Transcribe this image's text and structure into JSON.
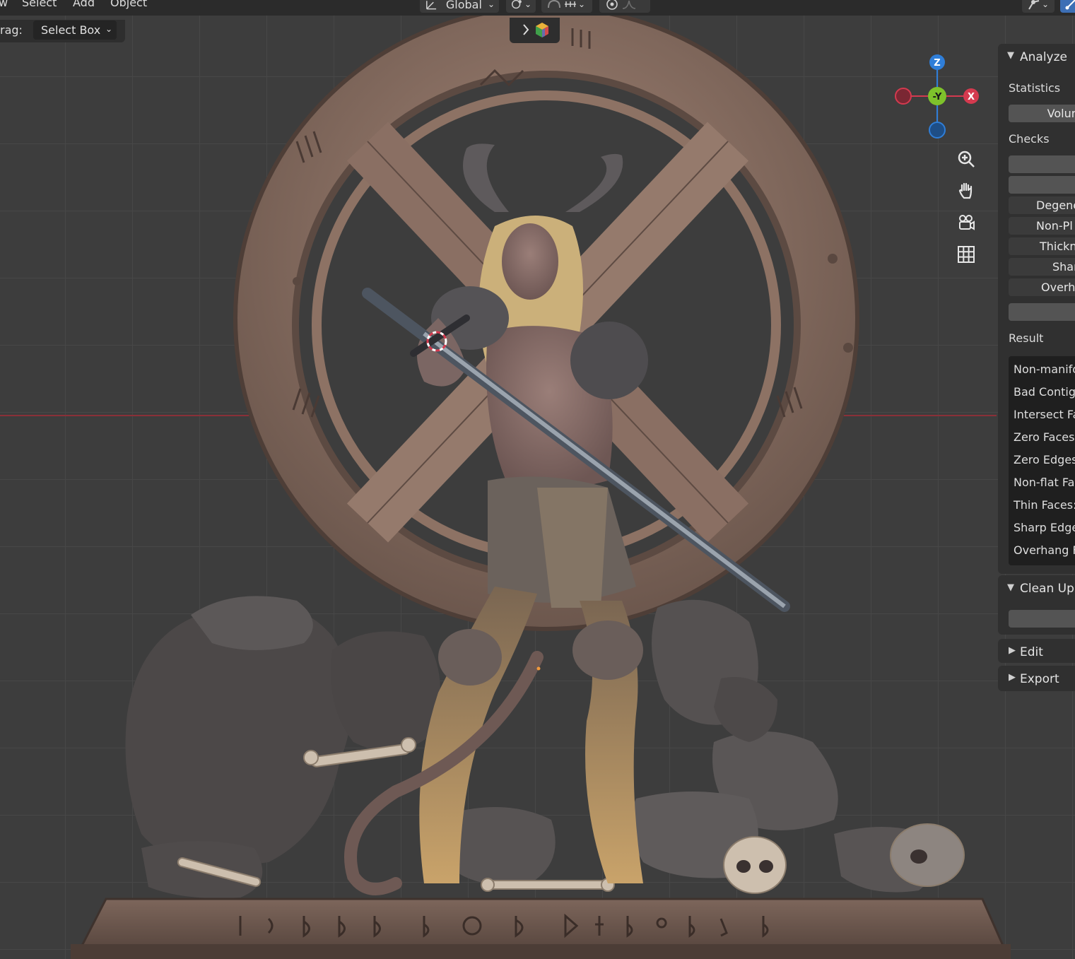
{
  "header": {
    "menu": [
      "w",
      "Select",
      "Add",
      "Object"
    ],
    "orientation": "Global"
  },
  "tool_settings": {
    "drag_label": "rag:",
    "drag_value": "Select Box"
  },
  "gizmo": {
    "z_label": "Z",
    "y_label": "-Y",
    "x_label": "X",
    "colors": {
      "z": "#2f7ed8",
      "y": "#7ec22b",
      "x": "#d43a4f"
    }
  },
  "nav_icons": [
    "zoom-icon",
    "hand-icon",
    "camera-icon",
    "grid-icon"
  ],
  "sidebar": {
    "analyze": {
      "title": "Analyze",
      "statistics_label": "Statistics",
      "volume_button": "Volur",
      "checks_label": "Checks",
      "checks": [
        "Degene",
        "Non-Pl",
        "Thickn",
        "Shar",
        "Overha"
      ],
      "result_label": "Result",
      "results": [
        "Non-manifo",
        "Bad Contigu",
        "Intersect Fa",
        "Zero Faces:",
        "Zero Edges",
        "Non-flat Fa",
        "Thin Faces:",
        "Sharp Edge",
        "Overhang F"
      ]
    },
    "cleanup": {
      "title": "Clean Up"
    },
    "edit": {
      "title": "Edit"
    },
    "export": {
      "title": "Export"
    }
  }
}
